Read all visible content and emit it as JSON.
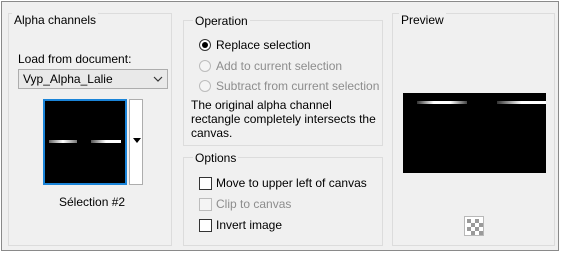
{
  "alpha_channels": {
    "title": "Alpha channels",
    "load_from_label": "Load from document:",
    "document_value": "Vyp_Alpha_Lalie",
    "selection_label": "Sélection #2"
  },
  "operation": {
    "title": "Operation",
    "options": [
      {
        "label": "Replace selection",
        "selected": true,
        "enabled": true
      },
      {
        "label": "Add to current selection",
        "selected": false,
        "enabled": false
      },
      {
        "label": "Subtract from current selection",
        "selected": false,
        "enabled": false
      }
    ],
    "message": [
      "The original alpha channel",
      "rectangle completely intersects the",
      "canvas."
    ]
  },
  "options": {
    "title": "Options",
    "items": [
      {
        "label": "Move to upper left of canvas",
        "checked": false,
        "enabled": true
      },
      {
        "label": "Clip to canvas",
        "checked": false,
        "enabled": false
      },
      {
        "label": "Invert image",
        "checked": false,
        "enabled": true
      }
    ]
  },
  "preview": {
    "title": "Preview"
  },
  "icons": {
    "dropdown": "chevron-down-icon",
    "thumb_dropdown": "triangle-down-icon",
    "preview_background": "checkerboard-icon"
  },
  "colors": {
    "selection_border": "#1a84d8",
    "dialog_background": "#f0f0f0"
  }
}
